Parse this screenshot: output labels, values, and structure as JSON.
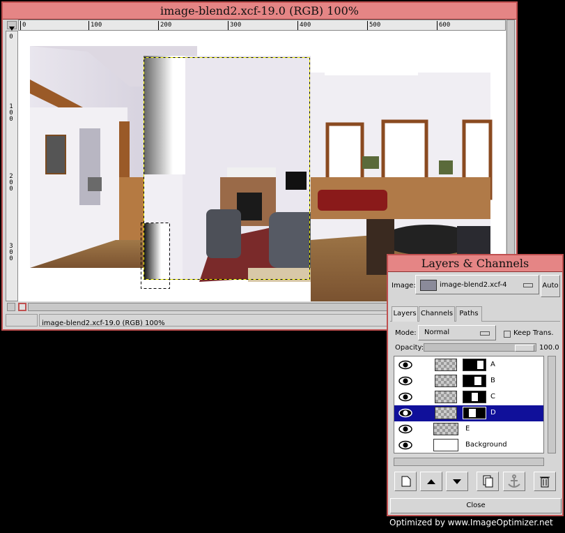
{
  "main_window": {
    "title": "image-blend2.xcf-19.0 (RGB) 100%",
    "status_text": "image-blend2.xcf-19.0 (RGB) 100%",
    "hruler_ticks": [
      "0",
      "100",
      "200",
      "300",
      "400",
      "500",
      "600"
    ],
    "vruler_ticks": [
      "0",
      "1 0 0",
      "2 0 0",
      "3 0 0"
    ]
  },
  "layers_dialog": {
    "title": "Layers & Channels",
    "image_label": "Image:",
    "image_value": "image-blend2.xcf-4",
    "auto_label": "Auto",
    "tabs": [
      "Layers",
      "Channels",
      "Paths"
    ],
    "mode_label": "Mode:",
    "mode_value": "Normal",
    "keep_trans_label": "Keep Trans.",
    "opacity_label": "Opacity:",
    "opacity_value": "100.0",
    "layers": [
      {
        "name": "A",
        "selected": false,
        "has_mask": true
      },
      {
        "name": "B",
        "selected": false,
        "has_mask": true
      },
      {
        "name": "C",
        "selected": false,
        "has_mask": true
      },
      {
        "name": "D",
        "selected": true,
        "has_mask": true
      },
      {
        "name": "E",
        "selected": false,
        "has_mask": false
      },
      {
        "name": "Background",
        "selected": false,
        "has_mask": false
      }
    ],
    "toolbar_icons": [
      "new-layer-icon",
      "raise-layer-icon",
      "lower-layer-icon",
      "duplicate-layer-icon",
      "anchor-layer-icon",
      "delete-layer-icon"
    ],
    "close_label": "Close"
  },
  "watermark": "Optimized by www.ImageOptimizer.net",
  "colors": {
    "titlebar": "#e58585",
    "selection": "#10109a",
    "frame": "#c05050"
  }
}
